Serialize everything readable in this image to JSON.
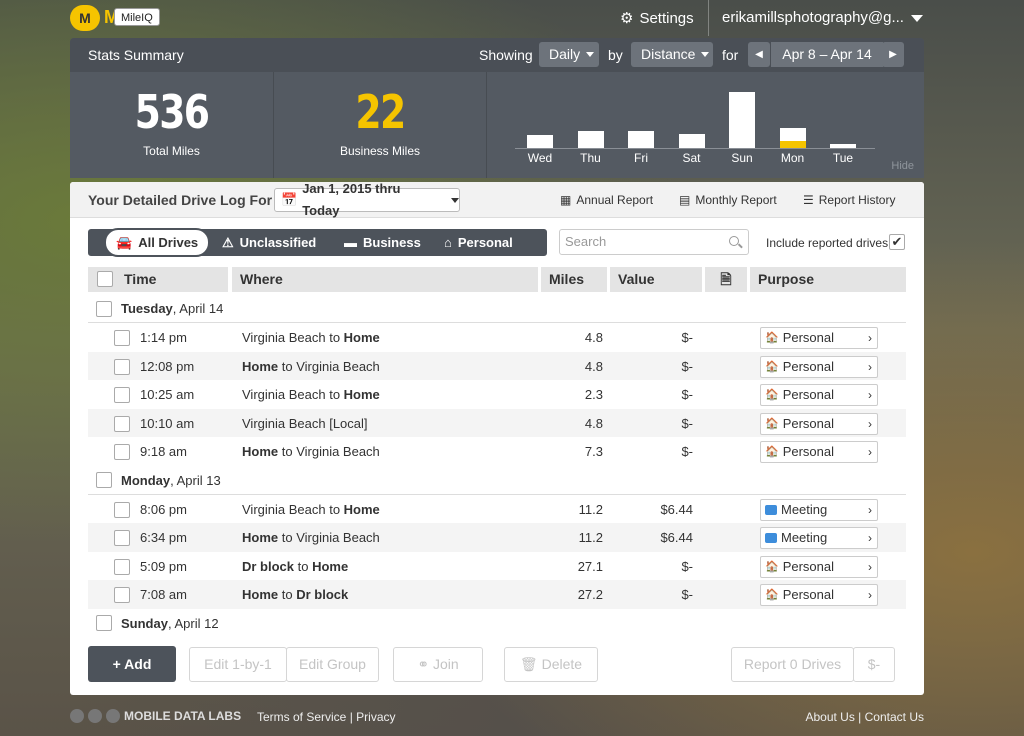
{
  "app": {
    "logo_letter": "M",
    "tooltip": "MileIQ"
  },
  "topbar": {
    "settings": "Settings",
    "account": "erikamillsphotography@g..."
  },
  "stats": {
    "title": "Stats Summary",
    "showing_label": "Showing",
    "period": "Daily",
    "by_label": "by",
    "metric": "Distance",
    "for_label": "for",
    "date_range": "Apr 8 – Apr 14",
    "total_miles": "536",
    "total_miles_label": "Total Miles",
    "business_miles": "22",
    "business_miles_label": "Business Miles",
    "hide": "Hide"
  },
  "chart_data": {
    "type": "bar",
    "categories": [
      "Wed",
      "Thu",
      "Fri",
      "Sat",
      "Sun",
      "Mon",
      "Tue"
    ],
    "series": [
      {
        "values": [
          15,
          20,
          20,
          17,
          67,
          16,
          5
        ]
      },
      {
        "values": [
          0,
          0,
          0,
          0,
          0,
          8,
          0
        ]
      }
    ],
    "colors": [
      "#ffffff",
      "#f5c400"
    ]
  },
  "log": {
    "title": "Your Detailed Drive Log For",
    "date_filter": "Jan 1, 2015 thru Today",
    "annual_report": "Annual Report",
    "monthly_report": "Monthly Report",
    "report_history": "Report History"
  },
  "filters": {
    "all": "All Drives",
    "unclassified": "Unclassified",
    "business": "Business",
    "personal": "Personal",
    "search_placeholder": "Search",
    "include_reported": "Include reported drives",
    "include_checked": "✔"
  },
  "columns": {
    "time": "Time",
    "where": "Where",
    "miles": "Miles",
    "value": "Value",
    "purpose": "Purpose"
  },
  "days": [
    {
      "day": "Tuesday",
      "date": ", April 14",
      "drives": [
        {
          "time": "1:14 pm",
          "from": "Virginia Beach",
          "to": "Home",
          "bold": "to",
          "miles": "4.8",
          "value": "$-",
          "purpose": "Personal",
          "ptype": "home"
        },
        {
          "time": "12:08 pm",
          "from": "Home",
          "to": "Virginia Beach",
          "bold": "from",
          "miles": "4.8",
          "value": "$-",
          "purpose": "Personal",
          "ptype": "home"
        },
        {
          "time": "10:25 am",
          "from": "Virginia Beach",
          "to": "Home",
          "bold": "to",
          "miles": "2.3",
          "value": "$-",
          "purpose": "Personal",
          "ptype": "home"
        },
        {
          "time": "10:10 am",
          "from": "Virginia Beach [Local]",
          "to": "",
          "bold": "none",
          "miles": "4.8",
          "value": "$-",
          "purpose": "Personal",
          "ptype": "home"
        },
        {
          "time": "9:18 am",
          "from": "Home",
          "to": "Virginia Beach",
          "bold": "from",
          "miles": "7.3",
          "value": "$-",
          "purpose": "Personal",
          "ptype": "home"
        }
      ]
    },
    {
      "day": "Monday",
      "date": ", April 13",
      "drives": [
        {
          "time": "8:06 pm",
          "from": "Virginia Beach",
          "to": "Home",
          "bold": "to",
          "miles": "11.2",
          "value": "$6.44",
          "purpose": "Meeting",
          "ptype": "meet"
        },
        {
          "time": "6:34 pm",
          "from": "Home",
          "to": "Virginia Beach",
          "bold": "from",
          "miles": "11.2",
          "value": "$6.44",
          "purpose": "Meeting",
          "ptype": "meet"
        },
        {
          "time": "5:09 pm",
          "from": "Dr block",
          "to": "Home",
          "bold": "both",
          "miles": "27.1",
          "value": "$-",
          "purpose": "Personal",
          "ptype": "home"
        },
        {
          "time": "7:08 am",
          "from": "Home",
          "to": "Dr block",
          "bold": "both",
          "miles": "27.2",
          "value": "$-",
          "purpose": "Personal",
          "ptype": "home"
        }
      ]
    },
    {
      "day": "Sunday",
      "date": ", April 12",
      "drives": []
    }
  ],
  "actions": {
    "add": "+ Add",
    "edit_one": "Edit 1-by-1",
    "edit_group": "Edit Group",
    "join": "Join",
    "delete": "Delete",
    "report": "Report 0 Drives",
    "dollar": "$-"
  },
  "footer": {
    "brand": "MOBILE DATA LABS",
    "terms": "Terms of Service",
    "privacy": "Privacy",
    "about": "About Us",
    "contact": "Contact Us"
  }
}
